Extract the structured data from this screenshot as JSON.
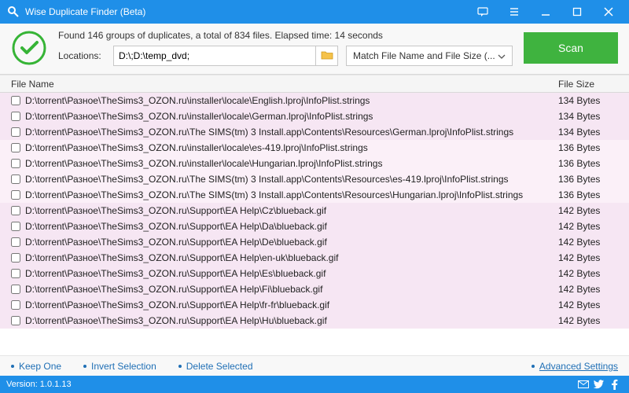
{
  "title": "Wise Duplicate Finder (Beta)",
  "header": {
    "summary": "Found 146 groups of duplicates, a total of 834 files. Elapsed time: 14 seconds",
    "locations_label": "Locations:",
    "locations_value": "D:\\;D:\\temp_dvd;",
    "match_mode": "Match File Name and File Size (...",
    "scan_label": "Scan"
  },
  "columns": {
    "name": "File Name",
    "size": "File Size"
  },
  "actions": {
    "keep_one": "Keep One",
    "invert": "Invert Selection",
    "delete": "Delete Selected",
    "advanced": "Advanced Settings"
  },
  "status": {
    "version": "Version: 1.0.1.13"
  },
  "rows": [
    {
      "group": 0,
      "name": "D:\\torrent\\Разное\\TheSims3_OZON.ru\\installer\\locale\\English.lproj\\InfoPlist.strings",
      "size": "134 Bytes"
    },
    {
      "group": 0,
      "name": "D:\\torrent\\Разное\\TheSims3_OZON.ru\\installer\\locale\\German.lproj\\InfoPlist.strings",
      "size": "134 Bytes"
    },
    {
      "group": 0,
      "name": "D:\\torrent\\Разное\\TheSims3_OZON.ru\\The SIMS(tm) 3 Install.app\\Contents\\Resources\\German.lproj\\InfoPlist.strings",
      "size": "134 Bytes"
    },
    {
      "group": 1,
      "name": "D:\\torrent\\Разное\\TheSims3_OZON.ru\\installer\\locale\\es-419.lproj\\InfoPlist.strings",
      "size": "136 Bytes"
    },
    {
      "group": 1,
      "name": "D:\\torrent\\Разное\\TheSims3_OZON.ru\\installer\\locale\\Hungarian.lproj\\InfoPlist.strings",
      "size": "136 Bytes"
    },
    {
      "group": 1,
      "name": "D:\\torrent\\Разное\\TheSims3_OZON.ru\\The SIMS(tm) 3 Install.app\\Contents\\Resources\\es-419.lproj\\InfoPlist.strings",
      "size": "136 Bytes"
    },
    {
      "group": 1,
      "name": "D:\\torrent\\Разное\\TheSims3_OZON.ru\\The SIMS(tm) 3 Install.app\\Contents\\Resources\\Hungarian.lproj\\InfoPlist.strings",
      "size": "136 Bytes"
    },
    {
      "group": 2,
      "name": "D:\\torrent\\Разное\\TheSims3_OZON.ru\\Support\\EA Help\\Cz\\blueback.gif",
      "size": "142 Bytes"
    },
    {
      "group": 2,
      "name": "D:\\torrent\\Разное\\TheSims3_OZON.ru\\Support\\EA Help\\Da\\blueback.gif",
      "size": "142 Bytes"
    },
    {
      "group": 2,
      "name": "D:\\torrent\\Разное\\TheSims3_OZON.ru\\Support\\EA Help\\De\\blueback.gif",
      "size": "142 Bytes"
    },
    {
      "group": 2,
      "name": "D:\\torrent\\Разное\\TheSims3_OZON.ru\\Support\\EA Help\\en-uk\\blueback.gif",
      "size": "142 Bytes"
    },
    {
      "group": 2,
      "name": "D:\\torrent\\Разное\\TheSims3_OZON.ru\\Support\\EA Help\\Es\\blueback.gif",
      "size": "142 Bytes"
    },
    {
      "group": 2,
      "name": "D:\\torrent\\Разное\\TheSims3_OZON.ru\\Support\\EA Help\\Fi\\blueback.gif",
      "size": "142 Bytes"
    },
    {
      "group": 2,
      "name": "D:\\torrent\\Разное\\TheSims3_OZON.ru\\Support\\EA Help\\fr-fr\\blueback.gif",
      "size": "142 Bytes"
    },
    {
      "group": 2,
      "name": "D:\\torrent\\Разное\\TheSims3_OZON.ru\\Support\\EA Help\\Hu\\blueback.gif",
      "size": "142 Bytes"
    }
  ]
}
